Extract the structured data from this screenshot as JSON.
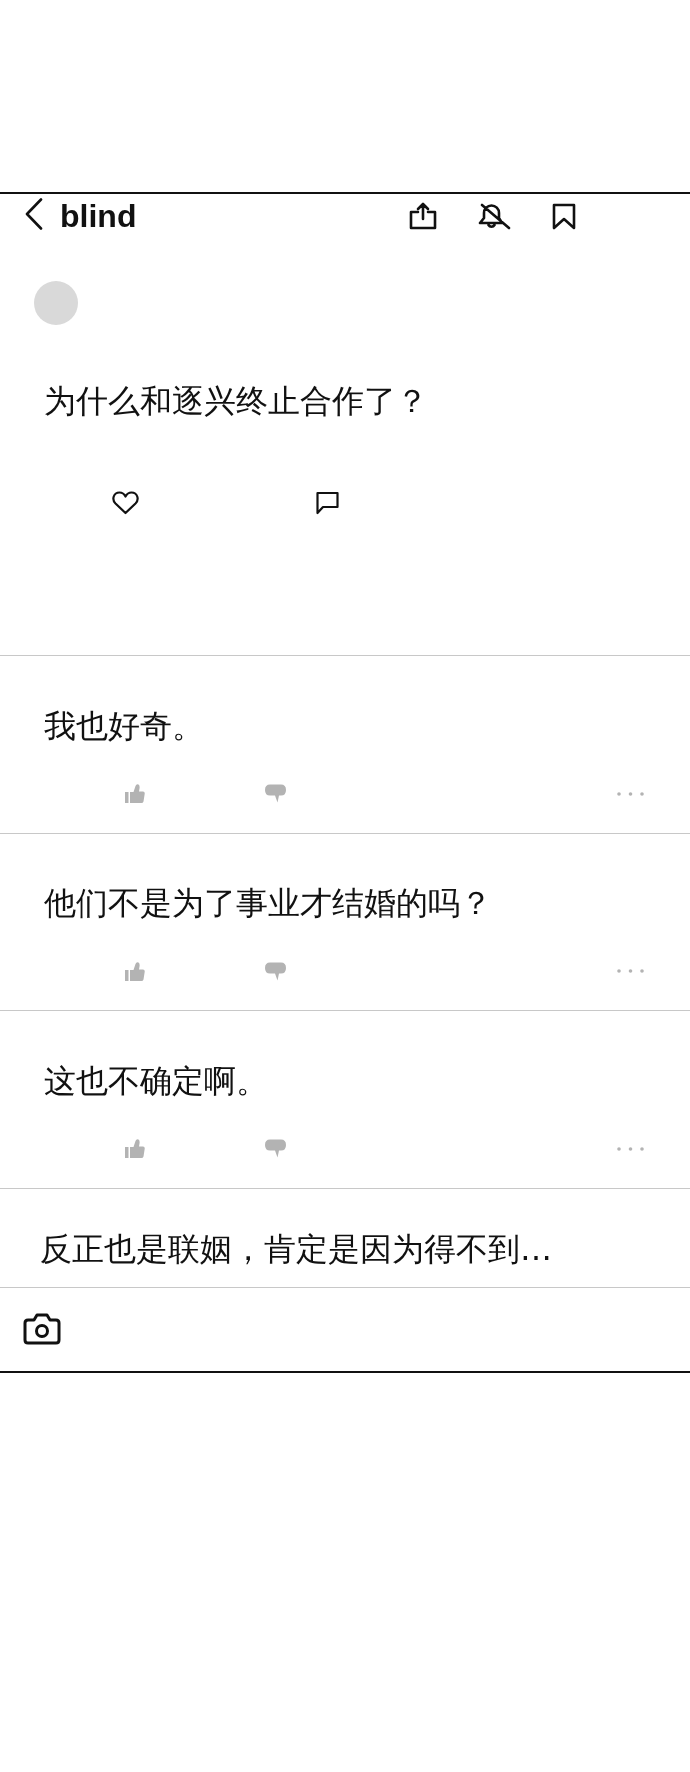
{
  "header": {
    "logo": "blind"
  },
  "post": {
    "title": "为什么和逐兴终止合作了？"
  },
  "comments": [
    {
      "kind": "comment",
      "text": "我也好奇。"
    },
    {
      "kind": "comment",
      "text": "他们不是为了事业才结婚的吗？"
    },
    {
      "kind": "comment",
      "text": "这也不确定啊。"
    },
    {
      "kind": "preview",
      "text": "反正也是联姻，肯定是因为得不到…"
    }
  ]
}
